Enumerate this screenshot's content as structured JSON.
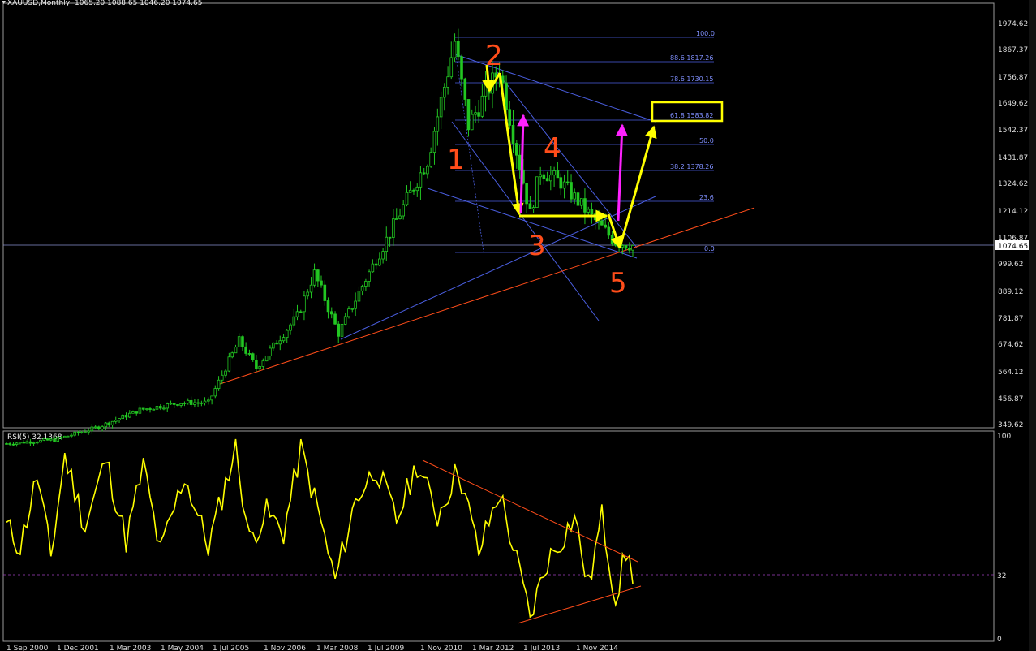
{
  "main_header": {
    "symbol": "XAUUSD,Monthly",
    "ohlc": "1065.20 1088.65 1046.20 1074.65"
  },
  "rsi_header": "RSI(5) 32.1368",
  "price_axis": [
    "1974.62",
    "1867.37",
    "1756.87",
    "1649.62",
    "1542.37",
    "1431.87",
    "1324.62",
    "1214.12",
    "1106.87",
    "999.62",
    "889.12",
    "781.87",
    "674.62",
    "564.12",
    "456.87",
    "349.62"
  ],
  "current_price": "1074.65",
  "rsi_axis": [
    "100",
    "32",
    "0"
  ],
  "x_axis": [
    "1 Sep 2000",
    "1 Dec 2001",
    "1 Mar 2003",
    "1 May 2004",
    "1 Jul 2005",
    "1 Nov 2006",
    "1 Mar 2008",
    "1 Jul 2009",
    "1 Nov 2010",
    "1 Mar 2012",
    "1 Jul 2013",
    "1 Nov 2014"
  ],
  "fib_labels": [
    "100.0",
    "88.6 1817.26",
    "78.6 1730.15",
    "61.8 1583.82",
    "50.0",
    "38.2 1378.26",
    "23.6",
    "0.0"
  ],
  "wave_labels": [
    "1",
    "2",
    "3",
    "4",
    "5"
  ],
  "colors": {
    "background": "#000000",
    "candles": "#22c722",
    "rsi_line": "#ffff00",
    "trendline": "#ff4d1a",
    "fib": "#4a5ee0",
    "arrows_yellow": "#ffff00",
    "arrows_magenta": "#ff22ff"
  },
  "chart_data": [
    {
      "type": "candlestick",
      "title": "XAUUSD,Monthly",
      "last_bar": {
        "open": 1065.2,
        "high": 1088.65,
        "low": 1046.2,
        "close": 1074.65
      },
      "x_start": "2000-09-01",
      "x_end": "2015-12-01",
      "ylim": [
        349.62,
        1974.62
      ],
      "anchors": [
        {
          "date": "2000-09-01",
          "price": 275
        },
        {
          "date": "2001-11-01",
          "price": 290
        },
        {
          "date": "2002-12-01",
          "price": 340
        },
        {
          "date": "2003-12-01",
          "price": 410
        },
        {
          "date": "2004-12-01",
          "price": 440
        },
        {
          "date": "2005-08-01",
          "price": 440
        },
        {
          "date": "2006-05-01",
          "price": 690
        },
        {
          "date": "2006-10-01",
          "price": 580
        },
        {
          "date": "2007-10-01",
          "price": 790
        },
        {
          "date": "2008-03-01",
          "price": 960
        },
        {
          "date": "2008-10-01",
          "price": 720
        },
        {
          "date": "2009-12-01",
          "price": 1100
        },
        {
          "date": "2010-12-01",
          "price": 1420
        },
        {
          "date": "2011-08-01",
          "price": 1900
        },
        {
          "date": "2011-12-01",
          "price": 1560
        },
        {
          "date": "2012-09-01",
          "price": 1790
        },
        {
          "date": "2013-06-01",
          "price": 1200
        },
        {
          "date": "2013-09-01",
          "price": 1380
        },
        {
          "date": "2014-03-01",
          "price": 1330
        },
        {
          "date": "2014-12-01",
          "price": 1190
        },
        {
          "date": "2015-07-01",
          "price": 1090
        },
        {
          "date": "2015-12-01",
          "price": 1075
        }
      ]
    },
    {
      "type": "line",
      "title": "RSI(5) 32.1368",
      "ylim": [
        0,
        100
      ],
      "levels": [
        32
      ],
      "anchors": [
        {
          "date": "2000-09-01",
          "value": 55
        },
        {
          "date": "2001-01-01",
          "value": 45
        },
        {
          "date": "2001-06-01",
          "value": 80
        },
        {
          "date": "2001-10-01",
          "value": 40
        },
        {
          "date": "2002-02-01",
          "value": 90
        },
        {
          "date": "2002-08-01",
          "value": 55
        },
        {
          "date": "2003-02-01",
          "value": 88
        },
        {
          "date": "2003-08-01",
          "value": 48
        },
        {
          "date": "2004-01-01",
          "value": 85
        },
        {
          "date": "2004-06-01",
          "value": 42
        },
        {
          "date": "2005-01-01",
          "value": 80
        },
        {
          "date": "2005-08-01",
          "value": 45
        },
        {
          "date": "2006-04-01",
          "value": 94
        },
        {
          "date": "2006-08-01",
          "value": 48
        },
        {
          "date": "2007-01-01",
          "value": 62
        },
        {
          "date": "2007-06-01",
          "value": 52
        },
        {
          "date": "2007-11-01",
          "value": 93
        },
        {
          "date": "2008-04-01",
          "value": 63
        },
        {
          "date": "2008-09-01",
          "value": 28
        },
        {
          "date": "2009-03-01",
          "value": 68
        },
        {
          "date": "2009-09-01",
          "value": 84
        },
        {
          "date": "2010-03-01",
          "value": 58
        },
        {
          "date": "2010-09-01",
          "value": 86
        },
        {
          "date": "2011-03-01",
          "value": 60
        },
        {
          "date": "2011-09-01",
          "value": 84
        },
        {
          "date": "2012-03-01",
          "value": 42
        },
        {
          "date": "2012-09-01",
          "value": 72
        },
        {
          "date": "2013-02-01",
          "value": 38
        },
        {
          "date": "2013-06-01",
          "value": 10
        },
        {
          "date": "2013-11-01",
          "value": 38
        },
        {
          "date": "2014-03-01",
          "value": 48
        },
        {
          "date": "2014-07-01",
          "value": 60
        },
        {
          "date": "2014-11-01",
          "value": 25
        },
        {
          "date": "2015-03-01",
          "value": 60
        },
        {
          "date": "2015-07-01",
          "value": 20
        },
        {
          "date": "2015-10-01",
          "value": 42
        },
        {
          "date": "2015-12-01",
          "value": 32.1368
        }
      ]
    }
  ]
}
